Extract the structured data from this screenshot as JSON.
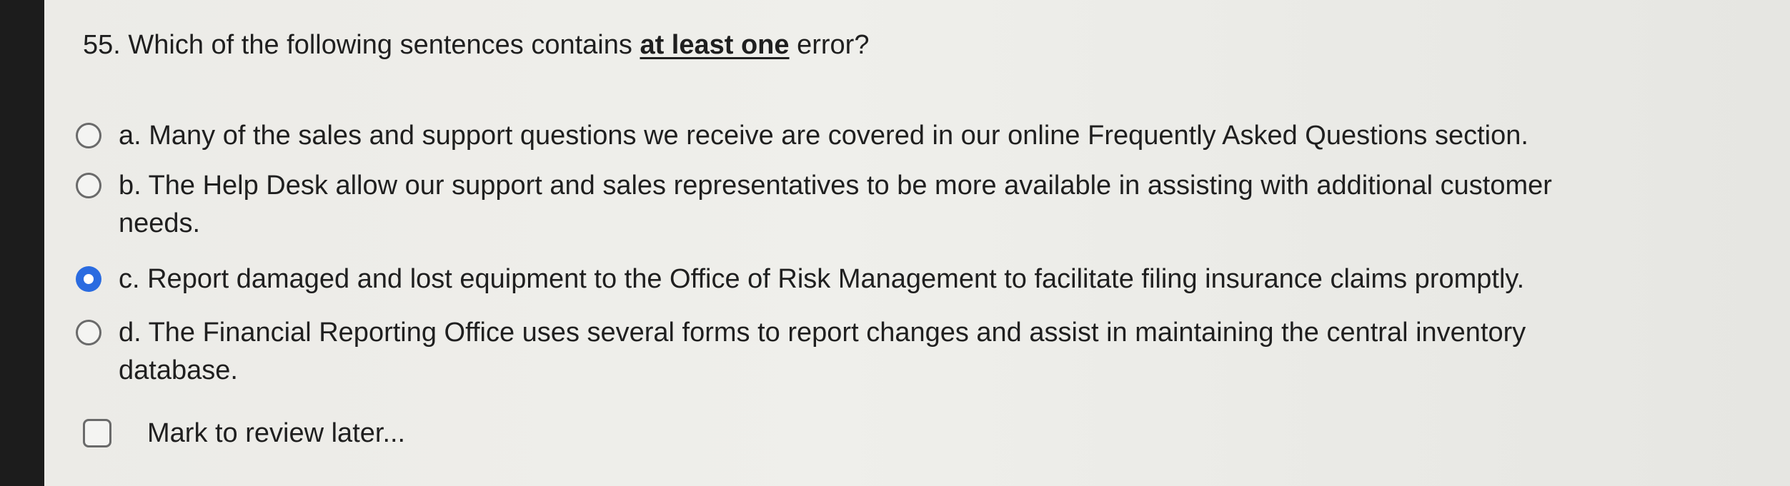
{
  "question": {
    "prefix": "55. Which of the following sentences contains ",
    "emphasis": "at least one",
    "suffix": " error?"
  },
  "options": [
    {
      "line1": "a. Many of the sales and support questions we receive are covered in our online Frequently Asked Questions section.",
      "line2": "",
      "selected": false
    },
    {
      "line1": "b. The Help Desk allow our support and sales representatives to be more available in assisting with additional customer",
      "line2": "needs.",
      "selected": false
    },
    {
      "line1": "c. Report damaged and lost equipment to the Office of Risk Management to facilitate filing insurance claims promptly.",
      "line2": "",
      "selected": true
    },
    {
      "line1": "d. The Financial Reporting Office uses several forms to report changes and assist in maintaining the central inventory",
      "line2": "database.",
      "selected": false
    }
  ],
  "review": {
    "label": "Mark to review later...",
    "checked": false
  },
  "colors": {
    "accent": "#2a6be0",
    "background": "#ecebe7",
    "text": "#1f1f1f"
  }
}
